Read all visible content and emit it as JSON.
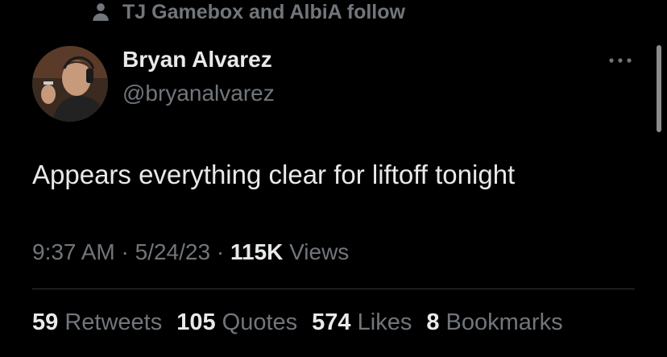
{
  "social_context": {
    "icon": "person-icon",
    "text": "TJ Gamebox and AlbiA follow"
  },
  "author": {
    "name": "Bryan Alvarez",
    "handle": "@bryanalvarez",
    "avatar_icon": "avatar-photo"
  },
  "more_icon": "more-options-icon",
  "tweet": {
    "text": "Appears everything clear for liftoff tonight"
  },
  "meta": {
    "time": "9:37 AM",
    "sep1": "·",
    "date": "5/24/23",
    "sep2": "·",
    "views_count": "115K",
    "views_label": "Views"
  },
  "stats": {
    "retweets_count": "59",
    "retweets_label": "Retweets",
    "quotes_count": "105",
    "quotes_label": "Quotes",
    "likes_count": "574",
    "likes_label": "Likes",
    "bookmarks_count": "8",
    "bookmarks_label": "Bookmarks"
  },
  "colors": {
    "background": "#000000",
    "primary_text": "#e7e9ea",
    "secondary_text": "#71767b",
    "divider": "#2f3336"
  }
}
